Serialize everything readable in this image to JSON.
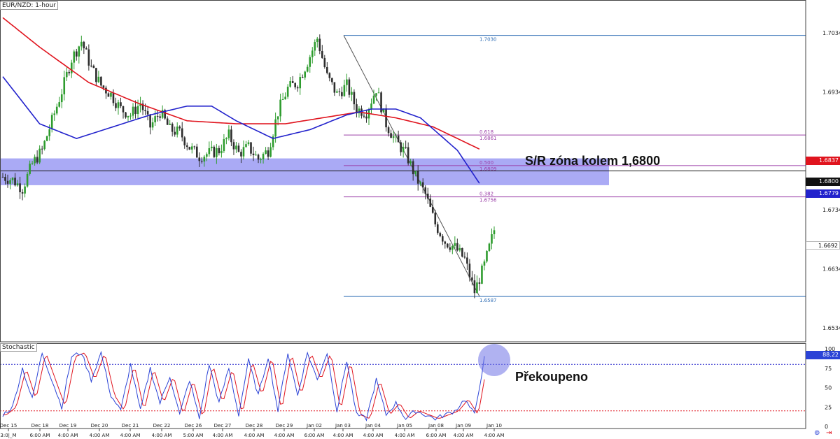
{
  "header": {
    "symbol_title": "EUR/NZD: 1-hour",
    "indicator_title": "Stochastic"
  },
  "annotations": {
    "sr_zone_label": "S/R zóna kolem 1,6800",
    "overbought_label": "Překoupeno"
  },
  "colors": {
    "up_candle": "#2e9c2e",
    "down_candle": "#2d2d2d",
    "ma_fast": "#2222cc",
    "ma_slow": "#e0141e",
    "fib_line": "#2f6db5",
    "fib_mid": "#9b3fa8",
    "sr_zone": "#8e8ef2",
    "stoch_k": "#2b43d6",
    "stoch_d": "#e0141e",
    "stoch_levels": "#e0141e",
    "circle": "#6f72e6"
  },
  "price_axis": {
    "labels": [
      "1.7034",
      "1.6934",
      "1.6734",
      "1.6634",
      "1.6534"
    ],
    "current_tags": [
      {
        "value": "1.6837",
        "bg": "#e0141e",
        "fg": "#ffffff"
      },
      {
        "value": "1.6800",
        "bg": "#111111",
        "fg": "#ffffff"
      },
      {
        "value": "1.6779",
        "bg": "#2222cc",
        "fg": "#ffffff"
      },
      {
        "value": "1.6692",
        "bg": "#ffffff",
        "fg": "#111111"
      }
    ]
  },
  "stoch_axis": {
    "labels": [
      "100",
      "75",
      "50",
      "25",
      "0"
    ],
    "current_tag": {
      "value": "88.22",
      "bg": "#2b43d6",
      "fg": "#ffffff"
    }
  },
  "time_axis": {
    "dates": [
      "Dec 15",
      "Dec 18",
      "Dec 19",
      "Dec 20",
      "Dec 21",
      "Dec 22",
      "Dec 26",
      "Dec 27",
      "Dec 28",
      "Dec 29",
      "Jan 02",
      "Jan 03",
      "Jan 04",
      "Jan 05",
      "Jan 08",
      "Jan 09",
      "Jan 10"
    ],
    "times": [
      "3:0|_M",
      "6:00 AM",
      "4:00 AM",
      "4:00 AM",
      "4:00 AM",
      "4:00 AM",
      "5:00 AM",
      "4:00 AM",
      "4:00 AM",
      "4:00 AM",
      "6:00 AM",
      "4:00 AM",
      "4:00 AM",
      "4:00 AM",
      "6:00 AM",
      "4:00 AM",
      "4:00 AM"
    ]
  },
  "fibonacci": [
    {
      "ratio": "",
      "price": "1.7030"
    },
    {
      "ratio": "0.618",
      "price": "1.6861"
    },
    {
      "ratio": "0.500",
      "price": "1.6809"
    },
    {
      "ratio": "0.382",
      "price": "1.6756"
    },
    {
      "ratio": "",
      "price": "1.6587"
    }
  ],
  "chart_data": {
    "type": "candlestick",
    "title": "EUR/NZD: 1-hour",
    "ylim": [
      1.651,
      1.709
    ],
    "horizontal_levels": {
      "sr_zone": [
        1.679,
        1.6807
      ],
      "sr_line": 1.68,
      "stoch_upper": 80,
      "stoch_lower": 20
    },
    "price_path": {
      "description_points_index_to_close": [
        [
          0,
          1.679
        ],
        [
          4,
          1.6785
        ],
        [
          8,
          1.677
        ],
        [
          12,
          1.6812
        ],
        [
          16,
          1.6835
        ],
        [
          20,
          1.6885
        ],
        [
          24,
          1.6935
        ],
        [
          28,
          1.699
        ],
        [
          32,
          1.702
        ],
        [
          36,
          1.6975
        ],
        [
          40,
          1.6945
        ],
        [
          44,
          1.693
        ],
        [
          48,
          1.6905
        ],
        [
          52,
          1.6895
        ],
        [
          56,
          1.6915
        ],
        [
          60,
          1.6875
        ],
        [
          64,
          1.69
        ],
        [
          68,
          1.687
        ],
        [
          72,
          1.6865
        ],
        [
          76,
          1.684
        ],
        [
          80,
          1.6825
        ],
        [
          84,
          1.683
        ],
        [
          88,
          1.6835
        ],
        [
          92,
          1.686
        ],
        [
          96,
          1.683
        ],
        [
          100,
          1.684
        ],
        [
          104,
          1.682
        ],
        [
          108,
          1.6835
        ],
        [
          112,
          1.69
        ],
        [
          116,
          1.694
        ],
        [
          120,
          1.695
        ],
        [
          124,
          1.6985
        ],
        [
          128,
          1.7025
        ],
        [
          132,
          1.696
        ],
        [
          136,
          1.693
        ],
        [
          140,
          1.6945
        ],
        [
          144,
          1.6905
        ],
        [
          148,
          1.69
        ],
        [
          152,
          1.694
        ],
        [
          156,
          1.688
        ],
        [
          160,
          1.685
        ],
        [
          164,
          1.683
        ],
        [
          168,
          1.679
        ],
        [
          172,
          1.676
        ],
        [
          176,
          1.671
        ],
        [
          180,
          1.668
        ],
        [
          184,
          1.667
        ],
        [
          188,
          1.665
        ],
        [
          192,
          1.6595
        ],
        [
          196,
          1.664
        ],
        [
          200,
          1.67
        ]
      ]
    },
    "series": [
      {
        "name": "",
        "role": "ma_fast"
      },
      {
        "name": "",
        "role": "ma_slow"
      }
    ],
    "ma_fast_points": [
      [
        0,
        1.696
      ],
      [
        15,
        1.688
      ],
      [
        30,
        1.6855
      ],
      [
        45,
        1.6875
      ],
      [
        60,
        1.6895
      ],
      [
        75,
        1.691
      ],
      [
        85,
        1.691
      ],
      [
        95,
        1.6885
      ],
      [
        110,
        1.6855
      ],
      [
        125,
        1.687
      ],
      [
        140,
        1.6895
      ],
      [
        150,
        1.6905
      ],
      [
        160,
        1.6905
      ],
      [
        170,
        1.689
      ],
      [
        185,
        1.6835
      ],
      [
        194,
        1.6779
      ]
    ],
    "ma_slow_points": [
      [
        0,
        1.706
      ],
      [
        15,
        1.701
      ],
      [
        35,
        1.695
      ],
      [
        55,
        1.6915
      ],
      [
        75,
        1.6885
      ],
      [
        95,
        1.688
      ],
      [
        115,
        1.688
      ],
      [
        130,
        1.689
      ],
      [
        145,
        1.69
      ],
      [
        160,
        1.689
      ],
      [
        175,
        1.6875
      ],
      [
        194,
        1.6837
      ]
    ],
    "stochastic_k_points": [
      [
        0,
        15
      ],
      [
        4,
        25
      ],
      [
        8,
        75
      ],
      [
        12,
        35
      ],
      [
        16,
        95
      ],
      [
        20,
        60
      ],
      [
        24,
        25
      ],
      [
        28,
        90
      ],
      [
        32,
        95
      ],
      [
        36,
        60
      ],
      [
        40,
        95
      ],
      [
        44,
        40
      ],
      [
        48,
        20
      ],
      [
        52,
        80
      ],
      [
        56,
        20
      ],
      [
        60,
        75
      ],
      [
        64,
        30
      ],
      [
        68,
        65
      ],
      [
        72,
        15
      ],
      [
        76,
        60
      ],
      [
        80,
        10
      ],
      [
        84,
        80
      ],
      [
        88,
        30
      ],
      [
        92,
        75
      ],
      [
        96,
        15
      ],
      [
        100,
        85
      ],
      [
        104,
        40
      ],
      [
        108,
        90
      ],
      [
        112,
        20
      ],
      [
        116,
        95
      ],
      [
        120,
        40
      ],
      [
        124,
        95
      ],
      [
        128,
        60
      ],
      [
        132,
        95
      ],
      [
        136,
        20
      ],
      [
        140,
        85
      ],
      [
        144,
        15
      ],
      [
        148,
        10
      ],
      [
        152,
        60
      ],
      [
        156,
        15
      ],
      [
        160,
        30
      ],
      [
        164,
        10
      ],
      [
        168,
        20
      ],
      [
        172,
        15
      ],
      [
        176,
        10
      ],
      [
        180,
        15
      ],
      [
        184,
        20
      ],
      [
        188,
        35
      ],
      [
        192,
        15
      ],
      [
        196,
        88
      ]
    ]
  }
}
